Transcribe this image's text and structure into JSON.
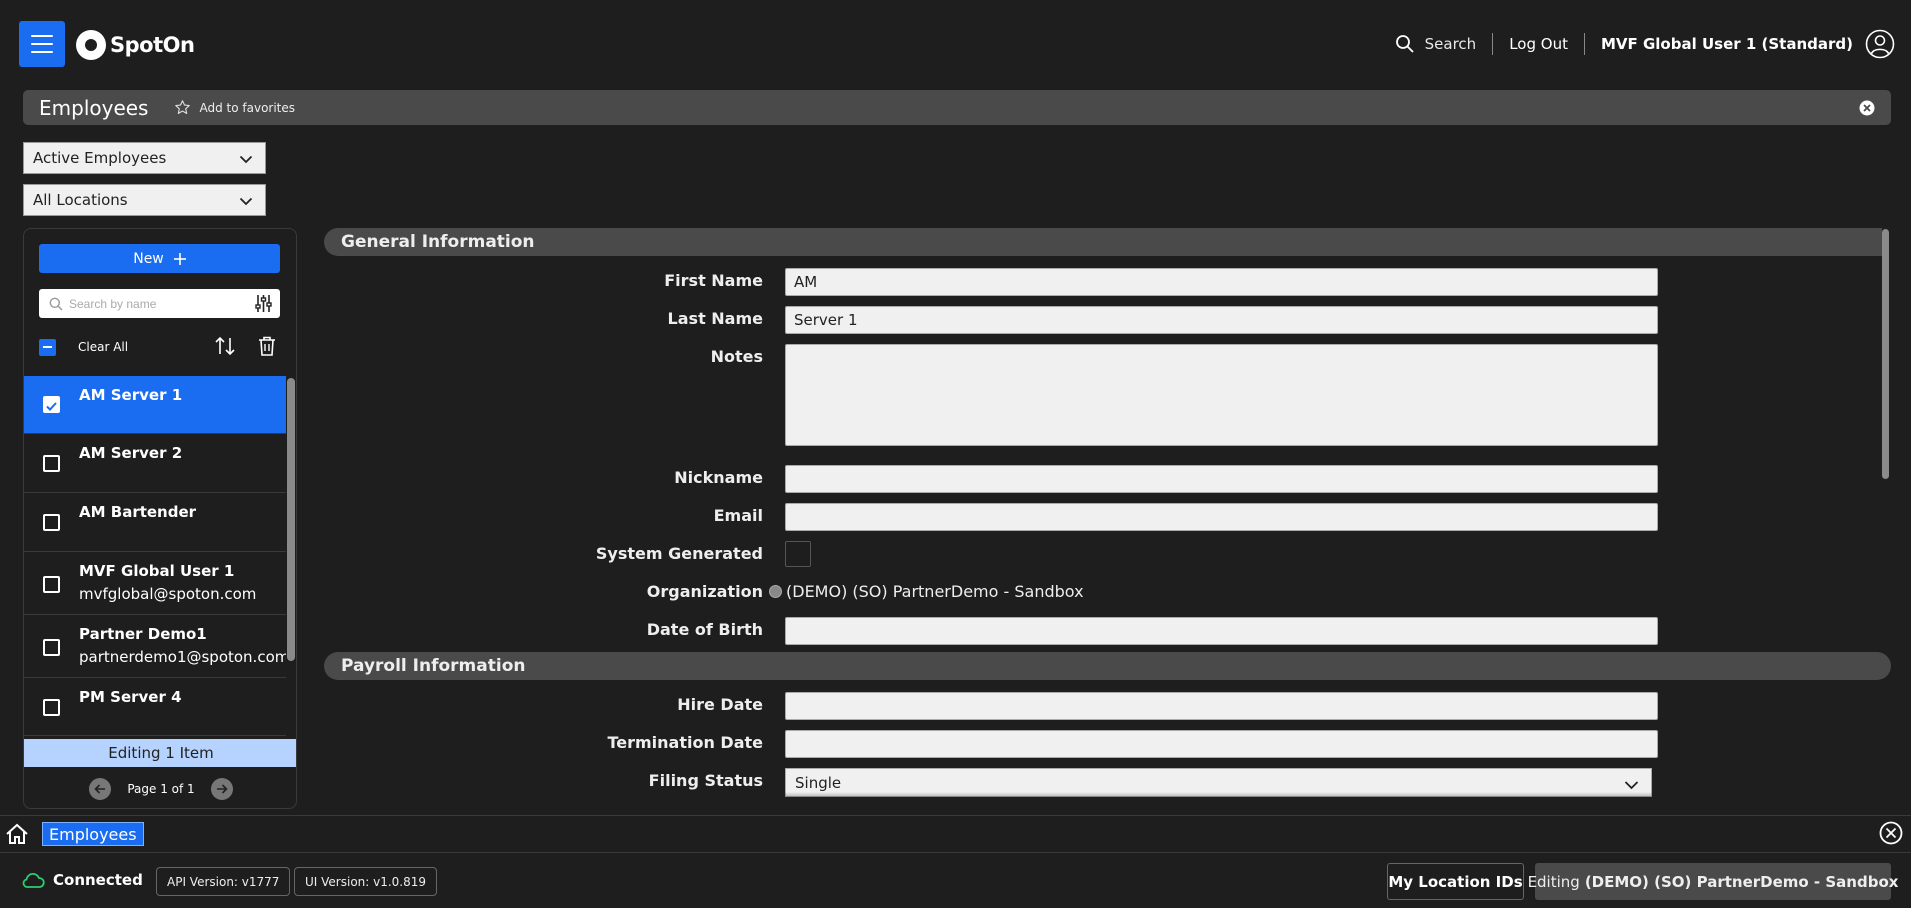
{
  "header": {
    "brand": "SpotOn",
    "search_label": "Search",
    "logout_label": "Log Out",
    "user_name": "MVF Global User 1 (Standard)"
  },
  "titlebar": {
    "title": "Employees",
    "favorites_label": "Add to favorites"
  },
  "filters": {
    "status_selected": "Active Employees",
    "location_selected": "All Locations"
  },
  "sidebar": {
    "new_label": "New",
    "search_placeholder": "Search by name",
    "clear_all_label": "Clear All",
    "items": [
      {
        "name": "AM Server 1",
        "sub": "",
        "selected": true
      },
      {
        "name": "AM Server 2",
        "sub": "",
        "selected": false
      },
      {
        "name": "AM Bartender",
        "sub": "",
        "selected": false
      },
      {
        "name": "MVF Global User 1",
        "sub": "mvfglobal@spoton.com",
        "selected": false
      },
      {
        "name": "Partner Demo1",
        "sub": "partnerdemo1@spoton.com",
        "selected": false
      },
      {
        "name": "PM Server 4",
        "sub": "",
        "selected": false
      }
    ],
    "editing_label": "Editing 1 Item",
    "page_label": "Page 1 of 1"
  },
  "form": {
    "general_title": "General Information",
    "payroll_title": "Payroll Information",
    "labels": {
      "first_name": "First Name",
      "last_name": "Last Name",
      "notes": "Notes",
      "nickname": "Nickname",
      "email": "Email",
      "system_generated": "System Generated",
      "organization": "Organization",
      "dob": "Date of Birth",
      "hire_date": "Hire Date",
      "termination_date": "Termination Date",
      "filing_status": "Filing Status"
    },
    "values": {
      "first_name": "AM",
      "last_name": "Server 1",
      "notes": "",
      "nickname": "",
      "email": "",
      "organization": "(DEMO) (SO) PartnerDemo - Sandbox",
      "dob": "",
      "hire_date": "",
      "termination_date": "",
      "filing_status": "Single"
    }
  },
  "tabs": {
    "active": "Employees"
  },
  "status": {
    "connection": "Connected",
    "api_version": "API Version: v1777",
    "ui_version": "UI Version: v1.0.819",
    "location_ids_label": "My Location IDs",
    "editing_prefix": "Editing",
    "editing_org": "(DEMO) (SO) PartnerDemo - Sandbox"
  },
  "colors": {
    "accent": "#1a6cf0",
    "background": "#1e1e1e",
    "connected": "#2ecc71"
  }
}
